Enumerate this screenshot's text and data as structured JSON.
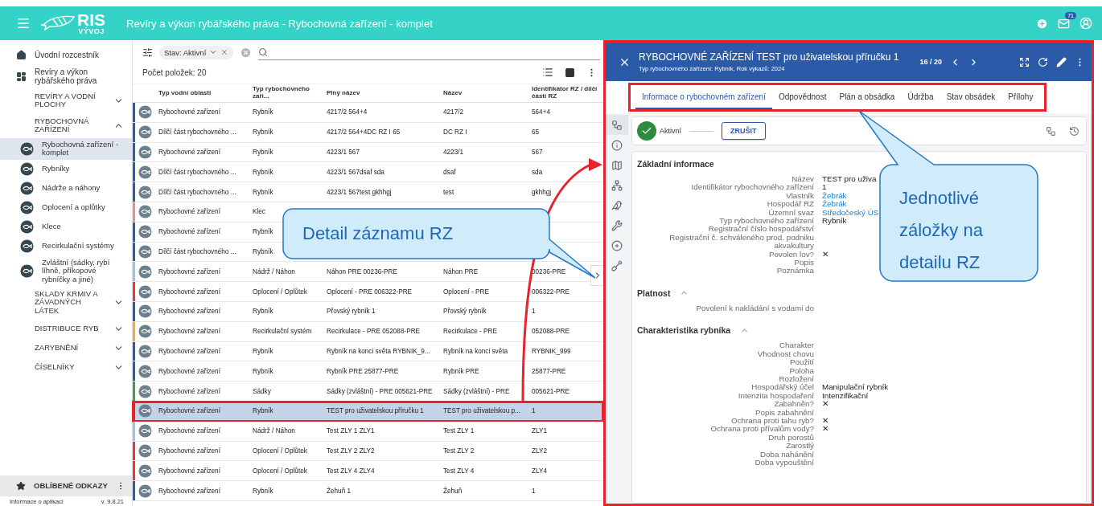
{
  "app_bar": {
    "logo_text": "RIS",
    "logo_subtext": "VÝVOJ",
    "title": "Revíry a výkon rybářského práva - Rybochovná zařízení - komplet",
    "mail_badge": "71"
  },
  "sidebar": {
    "items": [
      {
        "kind": "home",
        "label": "Úvodní rozcestník"
      },
      {
        "kind": "module",
        "label": "Revíry a výkon rybářského práva"
      },
      {
        "kind": "group",
        "label": "REVÍRY A VODNÍ PLOCHY",
        "expanded": false
      },
      {
        "kind": "group",
        "label": "RYBOCHOVNÁ ZAŘÍZENÍ",
        "expanded": true,
        "children": [
          {
            "label": "Rybochovná zařízení - komplet",
            "selected": true
          },
          {
            "label": "Rybníky",
            "selected": false
          },
          {
            "label": "Nádrže a náhony",
            "selected": false
          },
          {
            "label": "Oplocení a oplůtky",
            "selected": false
          },
          {
            "label": "Klece",
            "selected": false
          },
          {
            "label": "Recirkulační systémy",
            "selected": false
          },
          {
            "label": "Zvláštní (sádky, rybí líhně, příkopové rybníčky a jiné)",
            "selected": false
          }
        ]
      },
      {
        "kind": "group",
        "label": "SKLADY KRMIV A ZÁVADNÝCH LÁTEK",
        "expanded": false
      },
      {
        "kind": "group",
        "label": "DISTRIBUCE RYB",
        "expanded": false
      },
      {
        "kind": "group",
        "label": "ZARYBNĚNÍ",
        "expanded": false
      },
      {
        "kind": "group",
        "label": "ČÍSELNÍKY",
        "expanded": false
      }
    ],
    "favorites": "OBLÍBENÉ ODKAZY",
    "footer_left": "Informace o aplikaci",
    "footer_right": "v. 9.8.21"
  },
  "list": {
    "filter_chip": "Stav: Aktivní",
    "count": "Počet položek: 20",
    "columns": [
      "Typ vodní oblasti",
      "Typ rybochovného zaří...",
      "Plný název",
      "Název",
      "Identifikátor RZ / dílčí části RZ"
    ],
    "rows": [
      {
        "color": "#2d5bb0",
        "selected": false,
        "cells": [
          "Rybochovné zařízení",
          "Rybník",
          "4217/2 564+4",
          "4217/2",
          "564+4"
        ]
      },
      {
        "color": "#2d5bb0",
        "selected": false,
        "cells": [
          "Dílčí část rybochovného ...",
          "Rybník",
          "4217/2 564+4DC RZ I 65",
          "DC RZ I",
          "65"
        ]
      },
      {
        "color": "#2d5bb0",
        "selected": false,
        "cells": [
          "Rybochovné zařízení",
          "Rybník",
          "4223/1 567",
          "4223/1",
          "567"
        ]
      },
      {
        "color": "#2d5bb0",
        "selected": false,
        "cells": [
          "Dílčí část rybochovného ...",
          "Rybník",
          "4223/1 567dsaf sda",
          "dsaf",
          "sda"
        ]
      },
      {
        "color": "#2d5bb0",
        "selected": false,
        "cells": [
          "Dílčí část rybochovného ...",
          "Rybník",
          "4223/1 567test gkhhgj",
          "test",
          "gkhhgj"
        ]
      },
      {
        "color": "#f28b8b",
        "selected": false,
        "cells": [
          "Rybochovné zařízení",
          "Klec"
        ]
      },
      {
        "color": "#2d5bb0",
        "selected": false,
        "cells": [
          "Rybochovné zařízení",
          "Rybník"
        ]
      },
      {
        "color": "#2d5bb0",
        "selected": false,
        "cells": [
          "Dílčí část rybochovného ...",
          "Rybník"
        ]
      },
      {
        "color": "#9cc3e6",
        "selected": false,
        "cells": [
          "Rybochovné zařízení",
          "Nádrž / Náhon",
          "Náhon PRE 00236-PRE",
          "Náhon PRE",
          "00236-PRE"
        ]
      },
      {
        "color": "#e53935",
        "selected": false,
        "cells": [
          "Rybochovné zařízení",
          "Oplocení / Oplůtek",
          "Oplocení - PRE 006322-PRE",
          "Oplocení - PRE",
          "006322-PRE"
        ]
      },
      {
        "color": "#2d5bb0",
        "selected": false,
        "cells": [
          "Rybochovné zařízení",
          "Rybník",
          "Přovský rybník 1",
          "Přovský rybník",
          "1"
        ]
      },
      {
        "color": "#f6a93b",
        "selected": false,
        "cells": [
          "Rybochovné zařízení",
          "Recirkulační systém",
          "Recirkulace - PRE 052088-PRE",
          "Recirkulace - PRE",
          "052088-PRE"
        ]
      },
      {
        "color": "#2d5bb0",
        "selected": false,
        "cells": [
          "Rybochovné zařízení",
          "Rybník",
          "Rybník na konci světa RYBNIK_9...",
          "Rybník na konci světa",
          "RYBNIK_999"
        ]
      },
      {
        "color": "#2d5bb0",
        "selected": false,
        "cells": [
          "Rybochovné zařízení",
          "Rybník",
          "Rybník PRE 25877-PRE",
          "Rybník PRE",
          "25877-PRE"
        ]
      },
      {
        "color": "#43a047",
        "selected": false,
        "cells": [
          "Rybochovné zařízení",
          "Sádky",
          "Sádky (zvláštní) - PRE 005621-PRE",
          "Sádky (zvláštní) - PRE",
          "005621-PRE"
        ]
      },
      {
        "color": "#2d5bb0",
        "selected": true,
        "cells": [
          "Rybochovné zařízení",
          "Rybník",
          "TEST pro uživatelskou příručku 1",
          "TEST pro uživatelskou p...",
          "1"
        ]
      },
      {
        "color": "#9cc3e6",
        "selected": false,
        "cells": [
          "Rybochovné zařízení",
          "Nádrž / Náhon",
          "Test ZLY 1 ZLY1",
          "Test ZLY 1",
          "ZLY1"
        ]
      },
      {
        "color": "#e53935",
        "selected": false,
        "cells": [
          "Rybochovné zařízení",
          "Oplocení / Oplůtek",
          "Test ZLY 2 ZLY2",
          "Test ZLY 2",
          "ZLY2"
        ]
      },
      {
        "color": "#e53935",
        "selected": false,
        "cells": [
          "Rybochovné zařízení",
          "Oplocení / Oplůtek",
          "Test ZLY 4 ZLY4",
          "Test ZLY 4",
          "ZLY4"
        ]
      },
      {
        "color": "#2d5bb0",
        "selected": false,
        "cells": [
          "Rybochovné zařízení",
          "Rybník",
          "Žehuň 1",
          "Žehuň",
          "1"
        ]
      }
    ]
  },
  "detail": {
    "title": "RYBOCHOVNÉ ZAŘÍZENÍ TEST pro uživatelskou příručku 1",
    "subtitle": "Typ rybochovného zařízení: Rybník, Rok výkazů: 2024",
    "pager": "16 / 20",
    "tabs": [
      {
        "label": "Informace o rybochovném zařízení",
        "selected": true
      },
      {
        "label": "Odpovědnost",
        "selected": false
      },
      {
        "label": "Plán a obsádka",
        "selected": false
      },
      {
        "label": "Údržba",
        "selected": false
      },
      {
        "label": "Stav obsádek",
        "selected": false
      },
      {
        "label": "Přílohy",
        "selected": false
      }
    ],
    "rail": [
      {
        "selected": true
      },
      {
        "selected": false
      },
      {
        "selected": false
      },
      {
        "selected": false
      },
      {
        "selected": false
      },
      {
        "selected": false
      },
      {
        "selected": false
      },
      {
        "selected": false
      }
    ],
    "status": {
      "label": "Aktivní",
      "button": "ZRUŠIT"
    },
    "sections": [
      {
        "title": "Základní informace",
        "fields": [
          {
            "label": "Název",
            "value": "TEST pro uživa",
            "kind": "text"
          },
          {
            "label": "Identifikátor rybochovného zařízení",
            "value": "1",
            "kind": "text"
          },
          {
            "label": "Vlastník",
            "value": "Žebrák",
            "kind": "link"
          },
          {
            "label": "Hospodář RZ",
            "value": "Žebrák",
            "kind": "link"
          },
          {
            "label": "Územní svaz",
            "value": "Středočeský ÚS",
            "kind": "link"
          },
          {
            "label": "Typ rybochovného zařízení",
            "value": "Rybník",
            "kind": "text"
          },
          {
            "label": "Registrační číslo hospodářství"
          },
          {
            "label": "Registrační č. schváleného prod. podniku akvakultury"
          },
          {
            "label": "Povolen lov?",
            "value": "✕",
            "kind": "text"
          },
          {
            "label": "Popis"
          },
          {
            "label": "Poznámka"
          }
        ]
      },
      {
        "title": "Platnost",
        "expanded": true,
        "fields": [
          {
            "label": "Povolení k nakládání s vodami do"
          }
        ]
      },
      {
        "title": "Charakteristika rybníka",
        "expanded": true,
        "fields": [
          {
            "label": "Charakter"
          },
          {
            "label": "Vhodnost chovu"
          },
          {
            "label": "Použití"
          },
          {
            "label": "Poloha"
          },
          {
            "label": "Rozložení"
          },
          {
            "label": "Hospodářský účel",
            "value": "Manipulační rybník",
            "kind": "text"
          },
          {
            "label": "Intenzita hospodaření",
            "value": "Intenzifikační",
            "kind": "text"
          },
          {
            "label": "Zabahněn?",
            "value": "✕",
            "kind": "text"
          },
          {
            "label": "Popis zabahnění"
          },
          {
            "label": "Ochrana proti tahu ryb?",
            "value": "✕",
            "kind": "text"
          },
          {
            "label": "Ochrana proti přívalům vody?",
            "value": "✕",
            "kind": "text"
          },
          {
            "label": "Druh porostů"
          },
          {
            "label": "Zarostlý"
          },
          {
            "label": "Doba nahánění"
          },
          {
            "label": "Doba vypouštění"
          }
        ]
      }
    ]
  },
  "annotations": [
    {
      "text": "Detail záznamu RZ"
    },
    {
      "text": "Jednotlivé záložky na detailu RZ"
    }
  ]
}
